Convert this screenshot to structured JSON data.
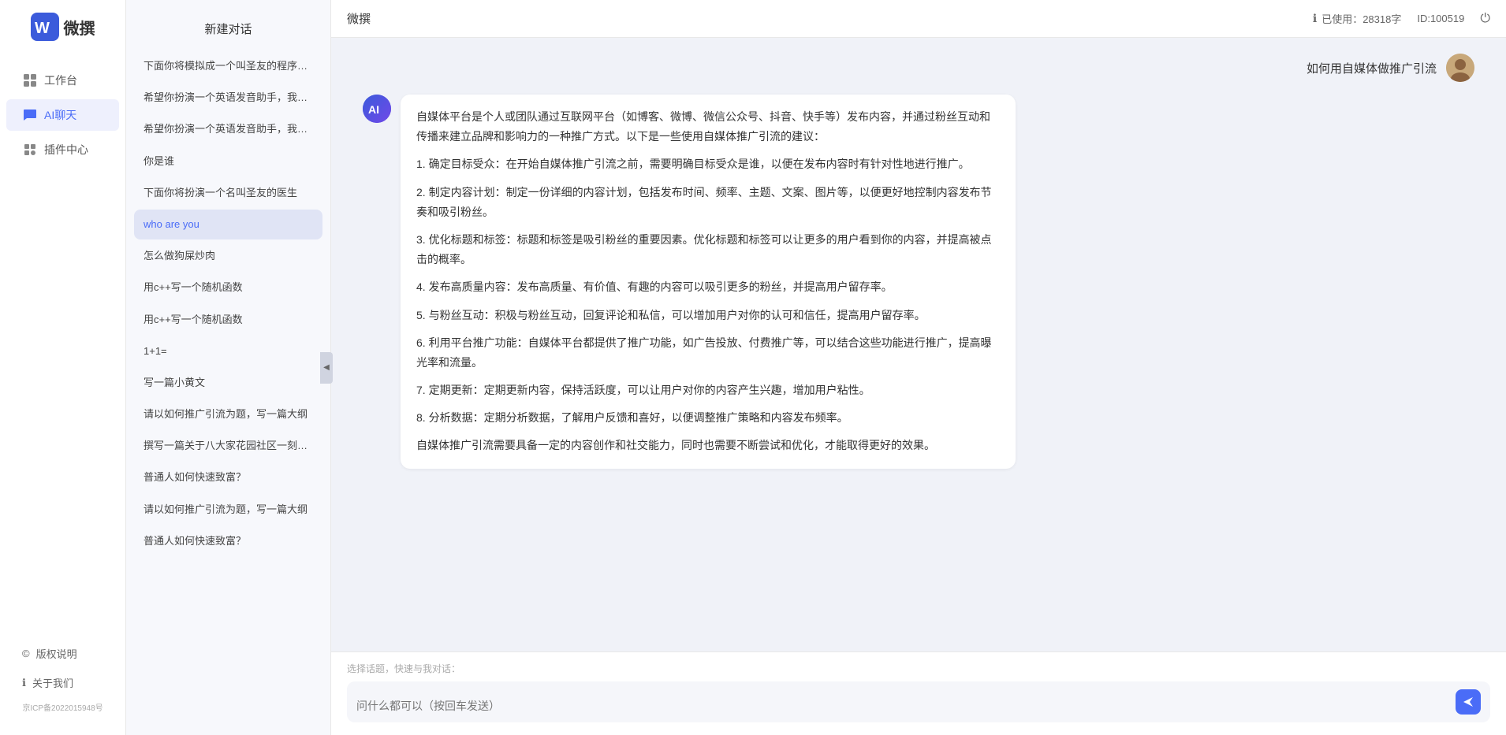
{
  "app": {
    "title": "微撰",
    "logo_letter": "W"
  },
  "topbar": {
    "title": "微撰",
    "usage_label": "已使用：28318字",
    "usage_icon": "ℹ",
    "id_label": "ID:100519",
    "logout_icon": "⏻"
  },
  "nav": {
    "items": [
      {
        "id": "workbench",
        "label": "工作台",
        "icon": "⊞"
      },
      {
        "id": "ai-chat",
        "label": "AI聊天",
        "icon": "💬",
        "active": true
      },
      {
        "id": "plugin",
        "label": "插件中心",
        "icon": "🔌"
      }
    ],
    "bottom_items": [
      {
        "id": "copyright",
        "label": "版权说明",
        "icon": "©"
      },
      {
        "id": "about",
        "label": "关于我们",
        "icon": "ℹ"
      }
    ],
    "icp": "京ICP备2022015948号"
  },
  "history": {
    "new_chat_label": "新建对话",
    "items": [
      {
        "id": 1,
        "text": "下面你将模拟成一个叫圣友的程序员，我说..."
      },
      {
        "id": 2,
        "text": "希望你扮演一个英语发音助手，我提供给你..."
      },
      {
        "id": 3,
        "text": "希望你扮演一个英语发音助手，我提供给你..."
      },
      {
        "id": 4,
        "text": "你是谁"
      },
      {
        "id": 5,
        "text": "下面你将扮演一个名叫圣友的医生"
      },
      {
        "id": 6,
        "text": "who are you",
        "active": true
      },
      {
        "id": 7,
        "text": "怎么做狗屎炒肉"
      },
      {
        "id": 8,
        "text": "用c++写一个随机函数"
      },
      {
        "id": 9,
        "text": "用c++写一个随机函数"
      },
      {
        "id": 10,
        "text": "1+1="
      },
      {
        "id": 11,
        "text": "写一篇小黄文"
      },
      {
        "id": 12,
        "text": "请以如何推广引流为题，写一篇大纲"
      },
      {
        "id": 13,
        "text": "撰写一篇关于八大家花园社区一刻钟便民生..."
      },
      {
        "id": 14,
        "text": "普通人如何快速致富？"
      },
      {
        "id": 15,
        "text": "请以如何推广引流为题，写一篇大纲"
      },
      {
        "id": 16,
        "text": "普通人如何快速致富？"
      }
    ]
  },
  "chat": {
    "user_question": "如何用自媒体做推广引流",
    "ai_response": {
      "paragraphs": [
        "自媒体平台是个人或团队通过互联网平台（如博客、微博、微信公众号、抖音、快手等）发布内容，并通过粉丝互动和传播来建立品牌和影响力的一种推广方式。以下是一些使用自媒体推广引流的建议：",
        "1. 确定目标受众：在开始自媒体推广引流之前，需要明确目标受众是谁，以便在发布内容时有针对性地进行推广。",
        "2. 制定内容计划：制定一份详细的内容计划，包括发布时间、频率、主题、文案、图片等，以便更好地控制内容发布节奏和吸引粉丝。",
        "3. 优化标题和标签：标题和标签是吸引粉丝的重要因素。优化标题和标签可以让更多的用户看到你的内容，并提高被点击的概率。",
        "4. 发布高质量内容：发布高质量、有价值、有趣的内容可以吸引更多的粉丝，并提高用户留存率。",
        "5. 与粉丝互动：积极与粉丝互动，回复评论和私信，可以增加用户对你的认可和信任，提高用户留存率。",
        "6. 利用平台推广功能：自媒体平台都提供了推广功能，如广告投放、付费推广等，可以结合这些功能进行推广，提高曝光率和流量。",
        "7. 定期更新：定期更新内容，保持活跃度，可以让用户对你的内容产生兴趣，增加用户粘性。",
        "8. 分析数据：定期分析数据，了解用户反馈和喜好，以便调整推广策略和内容发布频率。",
        "自媒体推广引流需要具备一定的内容创作和社交能力，同时也需要不断尝试和优化，才能取得更好的效果。"
      ]
    }
  },
  "input": {
    "quick_label": "选择话题，快速与我对话：",
    "placeholder": "问什么都可以（按回车发送）"
  }
}
